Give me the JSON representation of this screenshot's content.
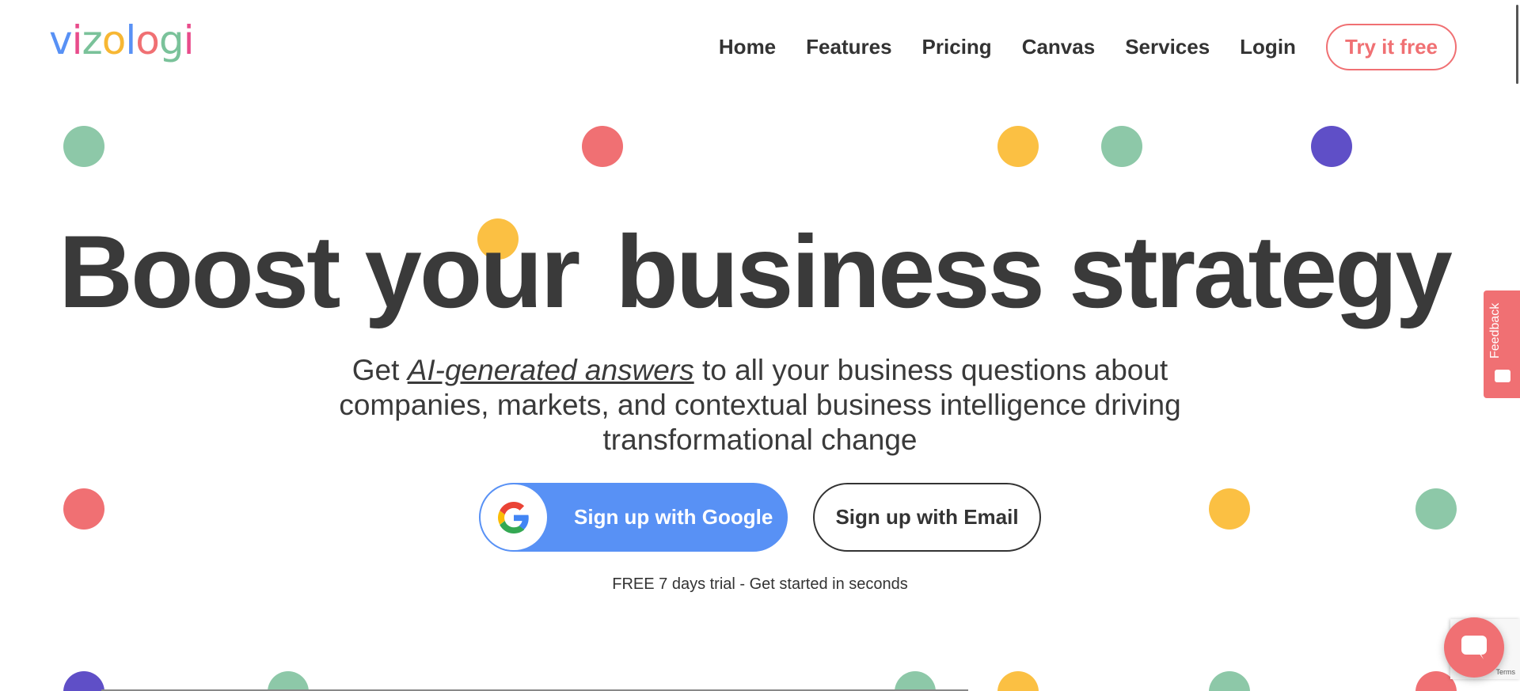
{
  "logo": {
    "text": "vizologi",
    "letter_colors": [
      "#5891f5",
      "#e84c8b",
      "#7ac29a",
      "#f7b733",
      "#5891f5",
      "#f07073",
      "#7ac29a",
      "#e84c8b"
    ]
  },
  "nav": {
    "items": [
      "Home",
      "Features",
      "Pricing",
      "Canvas",
      "Services",
      "Login"
    ],
    "cta": "Try it free"
  },
  "hero": {
    "title_plain": "Boost your",
    "title_highlight": "business strategy",
    "subtitle_before": "Get",
    "subtitle_em": "AI-generated answers",
    "subtitle_after": "to all your business questions about companies, markets, and contextual business intelligence driving transformational change",
    "google_button": "Sign up with Google",
    "email_button": "Sign up with Email",
    "trial_text": "FREE 7 days trial - Get started in seconds"
  },
  "widgets": {
    "feedback": "Feedback",
    "recaptcha_text": "Terms"
  },
  "colors": {
    "accent": "#f07073",
    "google_blue": "#5891f5",
    "highlight": "#ffff00",
    "green": "#8dc8a8",
    "yellow": "#fbc043",
    "purple": "#5f4fc7"
  }
}
